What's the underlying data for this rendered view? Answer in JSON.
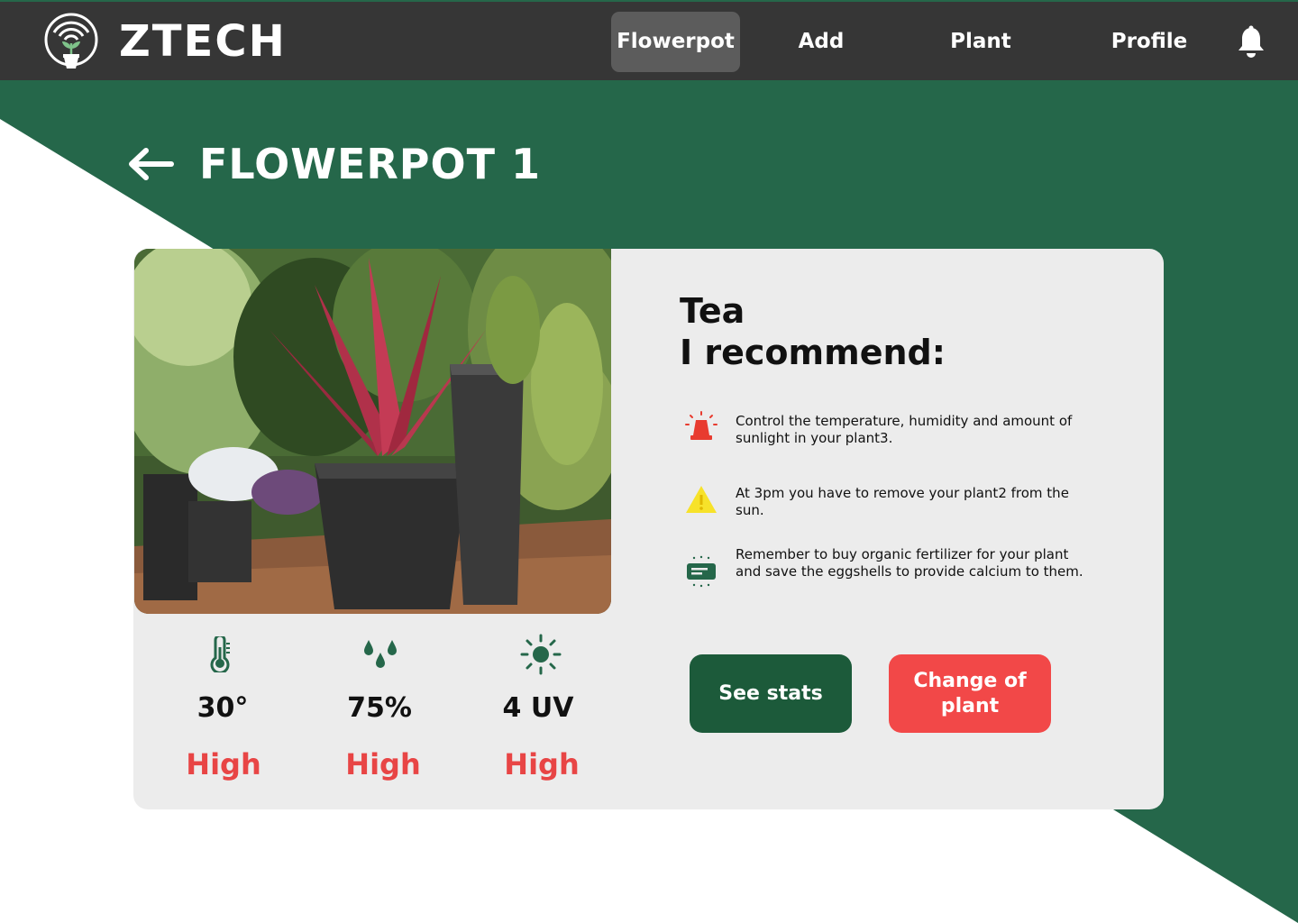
{
  "header": {
    "brand": "ZTECH",
    "nav": [
      {
        "label": "Flowerpot",
        "active": true
      },
      {
        "label": "Add",
        "active": false
      },
      {
        "label": "Plant",
        "active": false
      },
      {
        "label": "Profile",
        "active": false
      }
    ]
  },
  "page": {
    "title": "FLOWERPOT 1"
  },
  "stats": [
    {
      "icon": "thermometer-icon",
      "value": "30°",
      "level": "High"
    },
    {
      "icon": "water-drops-icon",
      "value": "75%",
      "level": "High"
    },
    {
      "icon": "sun-icon",
      "value": "4 UV",
      "level": "High"
    }
  ],
  "plant": {
    "name": "Tea",
    "recommend_heading": "I recommend:"
  },
  "recommendations": [
    {
      "icon": "siren-alarm-icon",
      "text": "Control the temperature, humidity and amount of sunlight in your plant3."
    },
    {
      "icon": "warning-icon",
      "text": "At 3pm you have to remove your plant2 from the sun."
    },
    {
      "icon": "note-icon",
      "text": "Remember to buy organic fertilizer for your plant and save the eggshells to provide calcium to them."
    }
  ],
  "buttons": {
    "see_stats": "See stats",
    "change_plant": "Change of plant"
  },
  "colors": {
    "brand_green": "#25674a",
    "nav_bg": "#363636",
    "alert_red": "#e84545",
    "button_green": "#1c5a3a",
    "button_red": "#f24848"
  }
}
